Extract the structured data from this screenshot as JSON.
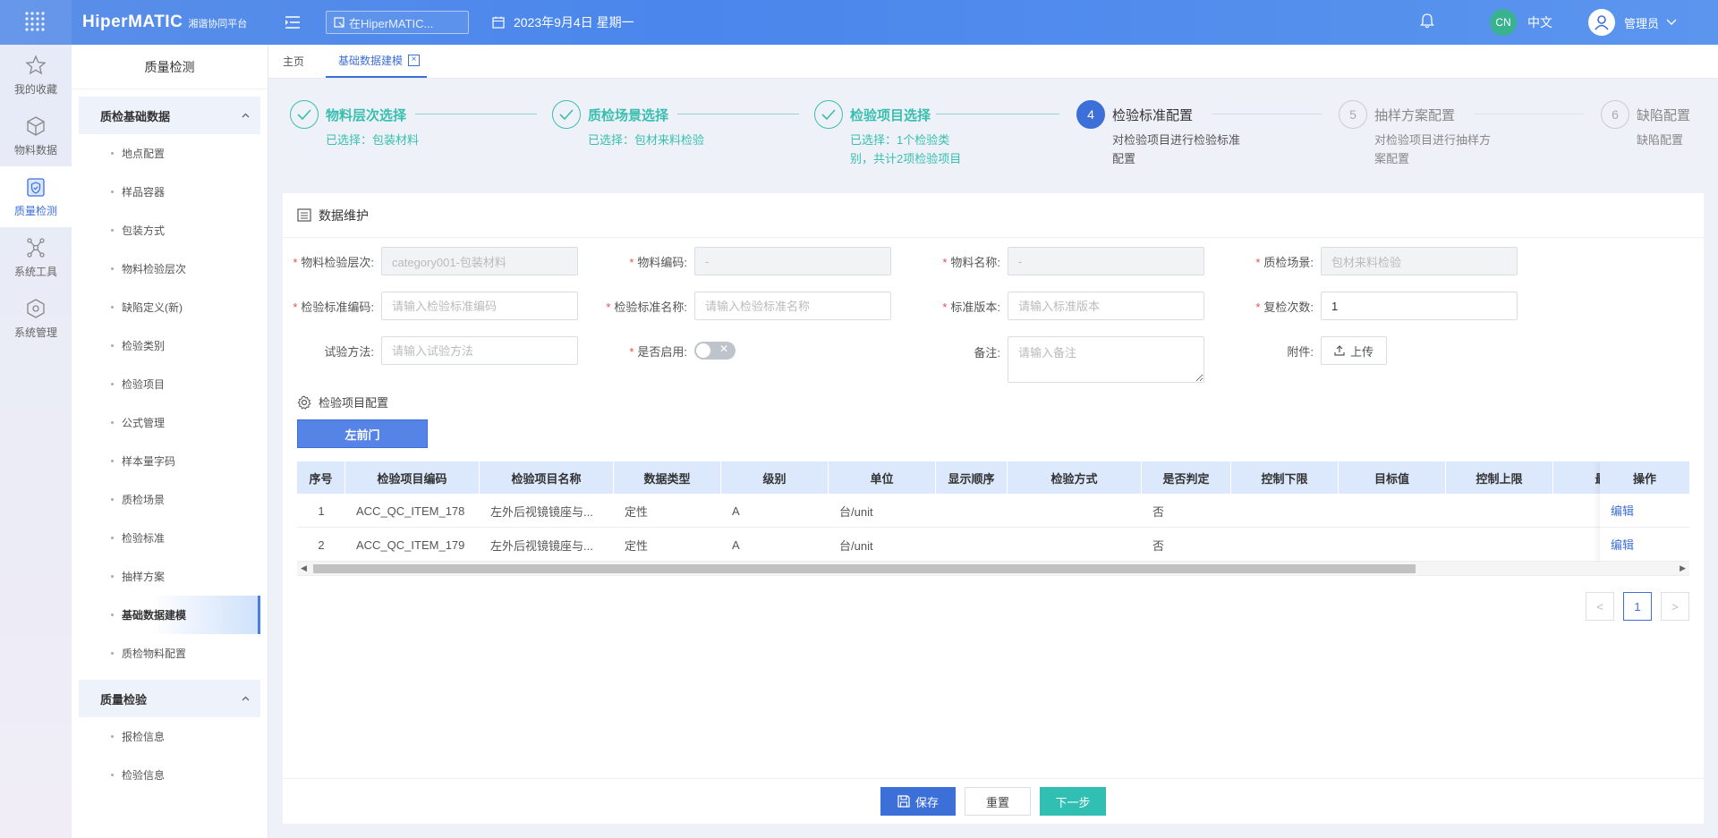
{
  "topbar": {
    "brand_main": "HiperMATIC",
    "brand_sub": "湘谐协同平台",
    "search_placeholder": "在HiperMATIC...",
    "date": "2023年9月4日 星期一",
    "lang_badge": "CN",
    "lang": "中文",
    "user": "管理员"
  },
  "rail": [
    {
      "label": "我的收藏",
      "icon": "star-icon"
    },
    {
      "label": "物料数据",
      "icon": "cube-icon"
    },
    {
      "label": "质量检测",
      "icon": "shield-clipboard-icon"
    },
    {
      "label": "系统工具",
      "icon": "network-icon"
    },
    {
      "label": "系统管理",
      "icon": "settings-cube-icon"
    }
  ],
  "sidebar": {
    "title": "质量检测",
    "group1": "质检基础数据",
    "items1": [
      "地点配置",
      "样品容器",
      "包装方式",
      "物料检验层次",
      "缺陷定义(新)",
      "检验类别",
      "检验项目",
      "公式管理",
      "样本量字码",
      "质检场景",
      "检验标准",
      "抽样方案",
      "基础数据建模",
      "质检物料配置"
    ],
    "group2": "质量检验",
    "items2": [
      "报检信息",
      "检验信息"
    ]
  },
  "tabs": {
    "home": "主页",
    "current": "基础数据建模"
  },
  "steps": [
    {
      "num": "",
      "title": "物料层次选择",
      "desc": "已选择：包装材料"
    },
    {
      "num": "",
      "title": "质检场景选择",
      "desc": "已选择：包材来料检验"
    },
    {
      "num": "",
      "title": "检验项目选择",
      "desc": "已选择：1个检验类别，共计2项检验项目"
    },
    {
      "num": "4",
      "title": "检验标准配置",
      "desc": "对检验项目进行检验标准配置"
    },
    {
      "num": "5",
      "title": "抽样方案配置",
      "desc": "对检验项目进行抽样方案配置"
    },
    {
      "num": "6",
      "title": "缺陷配置",
      "desc": "缺陷配置"
    }
  ],
  "panel": {
    "title": "数据维护"
  },
  "form": {
    "level_label": "物料检验层次:",
    "level_value": "category001-包装材料",
    "code_label": "物料编码:",
    "code_value": "-",
    "name_label": "物料名称:",
    "name_value": "-",
    "scene_label": "质检场景:",
    "scene_value": "包材来料检验",
    "std_code_label": "检验标准编码:",
    "std_code_ph": "请输入检验标准编码",
    "std_name_label": "检验标准名称:",
    "std_name_ph": "请输入检验标准名称",
    "version_label": "标准版本:",
    "version_ph": "请输入标准版本",
    "recheck_label": "复检次数:",
    "recheck_value": "1",
    "method_label": "试验方法:",
    "method_ph": "请输入试验方法",
    "enabled_label": "是否启用:",
    "enabled_mark": "✕",
    "remark_label": "备注:",
    "remark_ph": "请输入备注",
    "attach_label": "附件:",
    "upload": "上传"
  },
  "section2": {
    "title": "检验项目配置",
    "button": "左前门"
  },
  "table": {
    "headers": [
      "序号",
      "检验项目编码",
      "检验项目名称",
      "数据类型",
      "级别",
      "单位",
      "显示顺序",
      "检验方式",
      "是否判定",
      "控制下限",
      "目标值",
      "控制上限",
      "最大"
    ],
    "op_header": "操作",
    "rows": [
      [
        "1",
        "ACC_QC_ITEM_178",
        "左外后视镜镜座与...",
        "定性",
        "A",
        "台/unit",
        "",
        "",
        "否",
        "",
        "",
        "",
        ""
      ],
      [
        "2",
        "ACC_QC_ITEM_179",
        "左外后视镜镜座与...",
        "定性",
        "A",
        "台/unit",
        "",
        "",
        "否",
        "",
        "",
        "",
        ""
      ]
    ],
    "op_label": "编辑"
  },
  "pager": {
    "page": "1",
    "prev": "<",
    "next": ">"
  },
  "footer": {
    "save": "保存",
    "reset": "重置",
    "next": "下一步"
  },
  "colors": {
    "primary": "#3d6fd8",
    "teal": "#39bfb0",
    "next_btn": "#31bfb4"
  }
}
